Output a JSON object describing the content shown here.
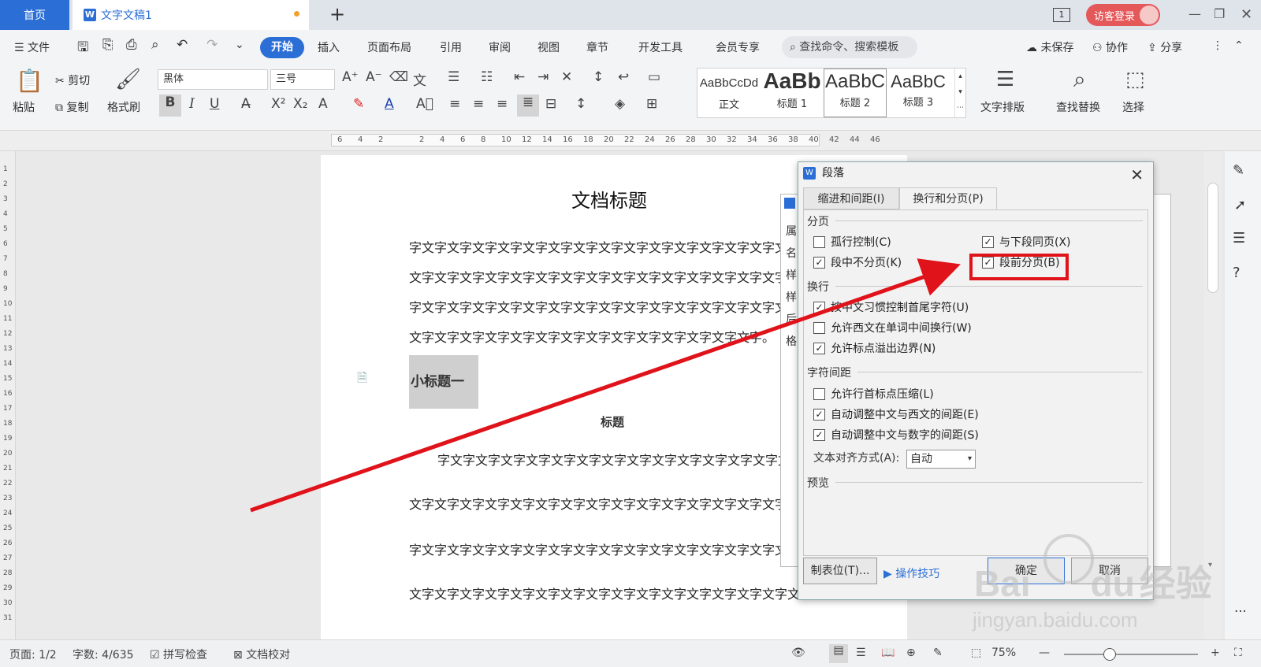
{
  "titlebar": {
    "home_tab": "首页",
    "doc_tab": "文字文稿1",
    "doc_tab_icon": "W",
    "page_badge": "1",
    "login": "访客登录"
  },
  "menu": {
    "file": "文件",
    "items": [
      "开始",
      "插入",
      "页面布局",
      "引用",
      "审阅",
      "视图",
      "章节",
      "开发工具",
      "会员专享"
    ],
    "search": "查找命令、搜索模板",
    "unsaved": "未保存",
    "collab": "协作",
    "share": "分享"
  },
  "ribbon": {
    "paste": "粘贴",
    "cut": "剪切",
    "copy": "复制",
    "format_painter": "格式刷",
    "font": "黑体",
    "size": "三号",
    "styles": [
      {
        "preview": "AaBbCcDd",
        "label": "正文"
      },
      {
        "preview": "AaBb",
        "label": "标题 1"
      },
      {
        "preview": "AaBbC",
        "label": "标题 2"
      },
      {
        "preview": "AaBbC",
        "label": "标题 3"
      }
    ],
    "text_layout": "文字排版",
    "find_replace": "查找替换",
    "select": "选择"
  },
  "ruler": {
    "marks": [
      "6",
      "4",
      "2",
      "",
      "2",
      "4",
      "6",
      "8",
      "10",
      "12",
      "14",
      "16",
      "18",
      "20",
      "22",
      "24",
      "26",
      "28",
      "30",
      "32",
      "34",
      "36",
      "38",
      "40",
      "42",
      "44",
      "46"
    ]
  },
  "vruler": {
    "marks": [
      "1",
      "2",
      "3",
      "4",
      "5",
      "6",
      "7",
      "8",
      "9",
      "10",
      "11",
      "12",
      "13",
      "14",
      "15",
      "16",
      "17",
      "18",
      "19",
      "20",
      "21",
      "22",
      "23",
      "24",
      "25",
      "26",
      "27",
      "28",
      "29",
      "30",
      "31"
    ]
  },
  "document": {
    "title": "文档标题",
    "lines": [
      "字文字文字文字文字文字文字文字文字文字文字文字文字文字文字文字",
      "文字文字文字文字文字文字文字文字文字文字文字文字文字文字文字文字文字文",
      "字文字文字文字文字文字文字文字文字文字文字文字文字文字文字文字文字文字",
      "文字文字文字文字文字文字文字文字文字文字文字文字文字文字。"
    ],
    "subheading": "小标题一",
    "small_title": "标题",
    "lines2": [
      "字文字文字文字文字文字文字文字文字文字文字文字文字文字文字文字文字",
      "文字文字文字文字文字文字文字文字文字文字文字文字文字文字文字文字文字",
      "字文字文字文字文字文字文字文字文字文字文字文字文字文字文字文字文字文字",
      "文字文字文字文字文字文字文字文字文字文字文字文字文字文字文字文字文字文"
    ]
  },
  "back_dialog": {
    "labels": [
      "属",
      "名",
      "样",
      "样",
      "后",
      "格"
    ]
  },
  "dialog": {
    "title": "段落",
    "tabs": [
      "缩进和间距(I)",
      "换行和分页(P)"
    ],
    "section_pagination": "分页",
    "widow": {
      "label": "孤行控制(C)",
      "checked": false
    },
    "keep_next": {
      "label": "与下段同页(X)",
      "checked": true
    },
    "keep_lines": {
      "label": "段中不分页(K)",
      "checked": true
    },
    "page_break_before": {
      "label": "段前分页(B)",
      "checked": true
    },
    "section_wrap": "换行",
    "wrap1": {
      "label": "按中文习惯控制首尾字符(U)",
      "checked": true
    },
    "wrap2": {
      "label": "允许西文在单词中间换行(W)",
      "checked": false
    },
    "wrap3": {
      "label": "允许标点溢出边界(N)",
      "checked": true
    },
    "section_spacing": "字符间距",
    "sp1": {
      "label": "允许行首标点压缩(L)",
      "checked": false
    },
    "sp2": {
      "label": "自动调整中文与西文的间距(E)",
      "checked": true
    },
    "sp3": {
      "label": "自动调整中文与数字的间距(S)",
      "checked": true
    },
    "align_label": "文本对齐方式(A):",
    "align_value": "自动",
    "section_preview": "预览",
    "tabs_button": "制表位(T)...",
    "tips": "操作技巧",
    "ok": "确定",
    "cancel": "取消"
  },
  "status": {
    "page": "页面: 1/2",
    "words": "字数: 4/635",
    "spell": "拼写检查",
    "proof": "文档校对",
    "zoom": "75%"
  },
  "watermark": {
    "brand": "Bai",
    "brand2": "du",
    "cn": "经验",
    "url": "jingyan.baidu.com"
  },
  "colors": {
    "accent": "#2b6fd6",
    "highlight": "#e0121a",
    "login": "#e5585a"
  }
}
